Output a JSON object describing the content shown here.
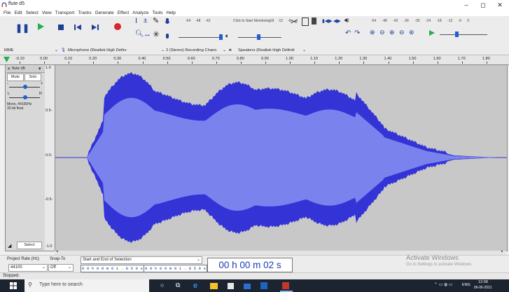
{
  "window": {
    "title": "flute d5",
    "minimize": "–",
    "maximize": "◻",
    "close": "✕"
  },
  "menu": [
    "File",
    "Edit",
    "Select",
    "View",
    "Transport",
    "Tracks",
    "Generate",
    "Effect",
    "Analyze",
    "Tools",
    "Help"
  ],
  "meters": {
    "record_scale": [
      "-54",
      "-48",
      "-42"
    ],
    "monitor_hint": "Click to Start Monitoring",
    "record_scale2": [
      "-18",
      "-12",
      "-6",
      "0"
    ],
    "play_scale": [
      "-54",
      "-48",
      "-42",
      "-36",
      "-30",
      "-24",
      "-18",
      "-12",
      "-6",
      "0"
    ]
  },
  "devices": {
    "host": "MME",
    "microphone": "Microphone (Realtek High Definı",
    "channels": "2 (Stereo) Recording Chann",
    "speakers": "Speakers (Realtek High Definiti"
  },
  "ruler": {
    "ticks": [
      "-0.10",
      "0.00",
      "0.10",
      "0.20",
      "0.30",
      "0.40",
      "0.50",
      "0.60",
      "0.70",
      "0.80",
      "0.90",
      "1.00",
      "1.10",
      "1.20",
      "1.30",
      "1.40",
      "1.50",
      "1.60",
      "1.70",
      "1.80"
    ]
  },
  "track": {
    "name": "flute d5",
    "mute": "Mute",
    "solo": "Solo",
    "pan_l": "L",
    "pan_r": "R",
    "info": "Mono, 44100Hz\n32-bit float",
    "select": "Select",
    "scale": [
      "1.0",
      "0.5-",
      "0.0-",
      "-0.5-",
      "-1.0"
    ]
  },
  "selection": {
    "project_rate_label": "Project Rate (Hz)",
    "snap_label": "Snap-To",
    "project_rate": "44100",
    "snap": "Off",
    "mode": "Start and End of Selection",
    "start": "0 0 h 0 0 m 0 1 . 8 5 9 s",
    "end": "0 0 h 0 0 m 0 1 . 8 5 9 s",
    "big_time": "00 h 00 m 02 s"
  },
  "watermark": {
    "line1": "Activate Windows",
    "line2": "Go to Settings to activate Windows."
  },
  "status": "Stopped.",
  "taskbar": {
    "search": "Type here to search",
    "tray": "ENG",
    "time": "12:08",
    "date": "06-06-2021"
  },
  "colors": {
    "wave_outer": "#3333d6",
    "wave_inner": "#7a82ee",
    "wave_bg": "#c8c8c8",
    "play_green": "#1fb14a",
    "record_red": "#d8262a"
  }
}
